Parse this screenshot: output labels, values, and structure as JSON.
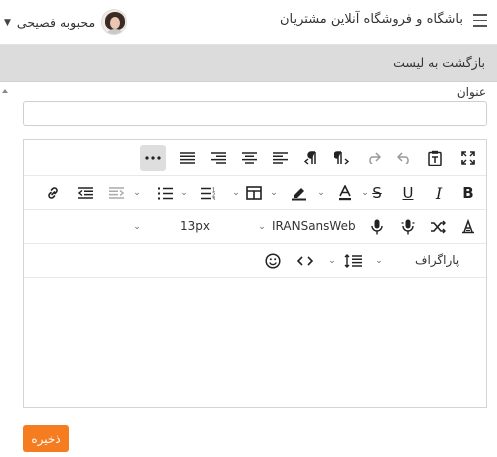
{
  "header": {
    "app_title": "باشگاه و فروشگاه آنلاین مشتریان",
    "user_name": "محبوبه فصیحی"
  },
  "subheader": {
    "back_label": "بازگشت به لیست"
  },
  "form": {
    "title_label": "عنوان",
    "title_value": "",
    "save_label": "ذخیره"
  },
  "editor": {
    "font_family": "IRANSansWeb",
    "font_size": "13px",
    "block_format": "پاراگراف"
  },
  "colors": {
    "accent": "#f57c1f",
    "toolbar_active": "#dedede",
    "header_bar": "#dcdcdc"
  }
}
